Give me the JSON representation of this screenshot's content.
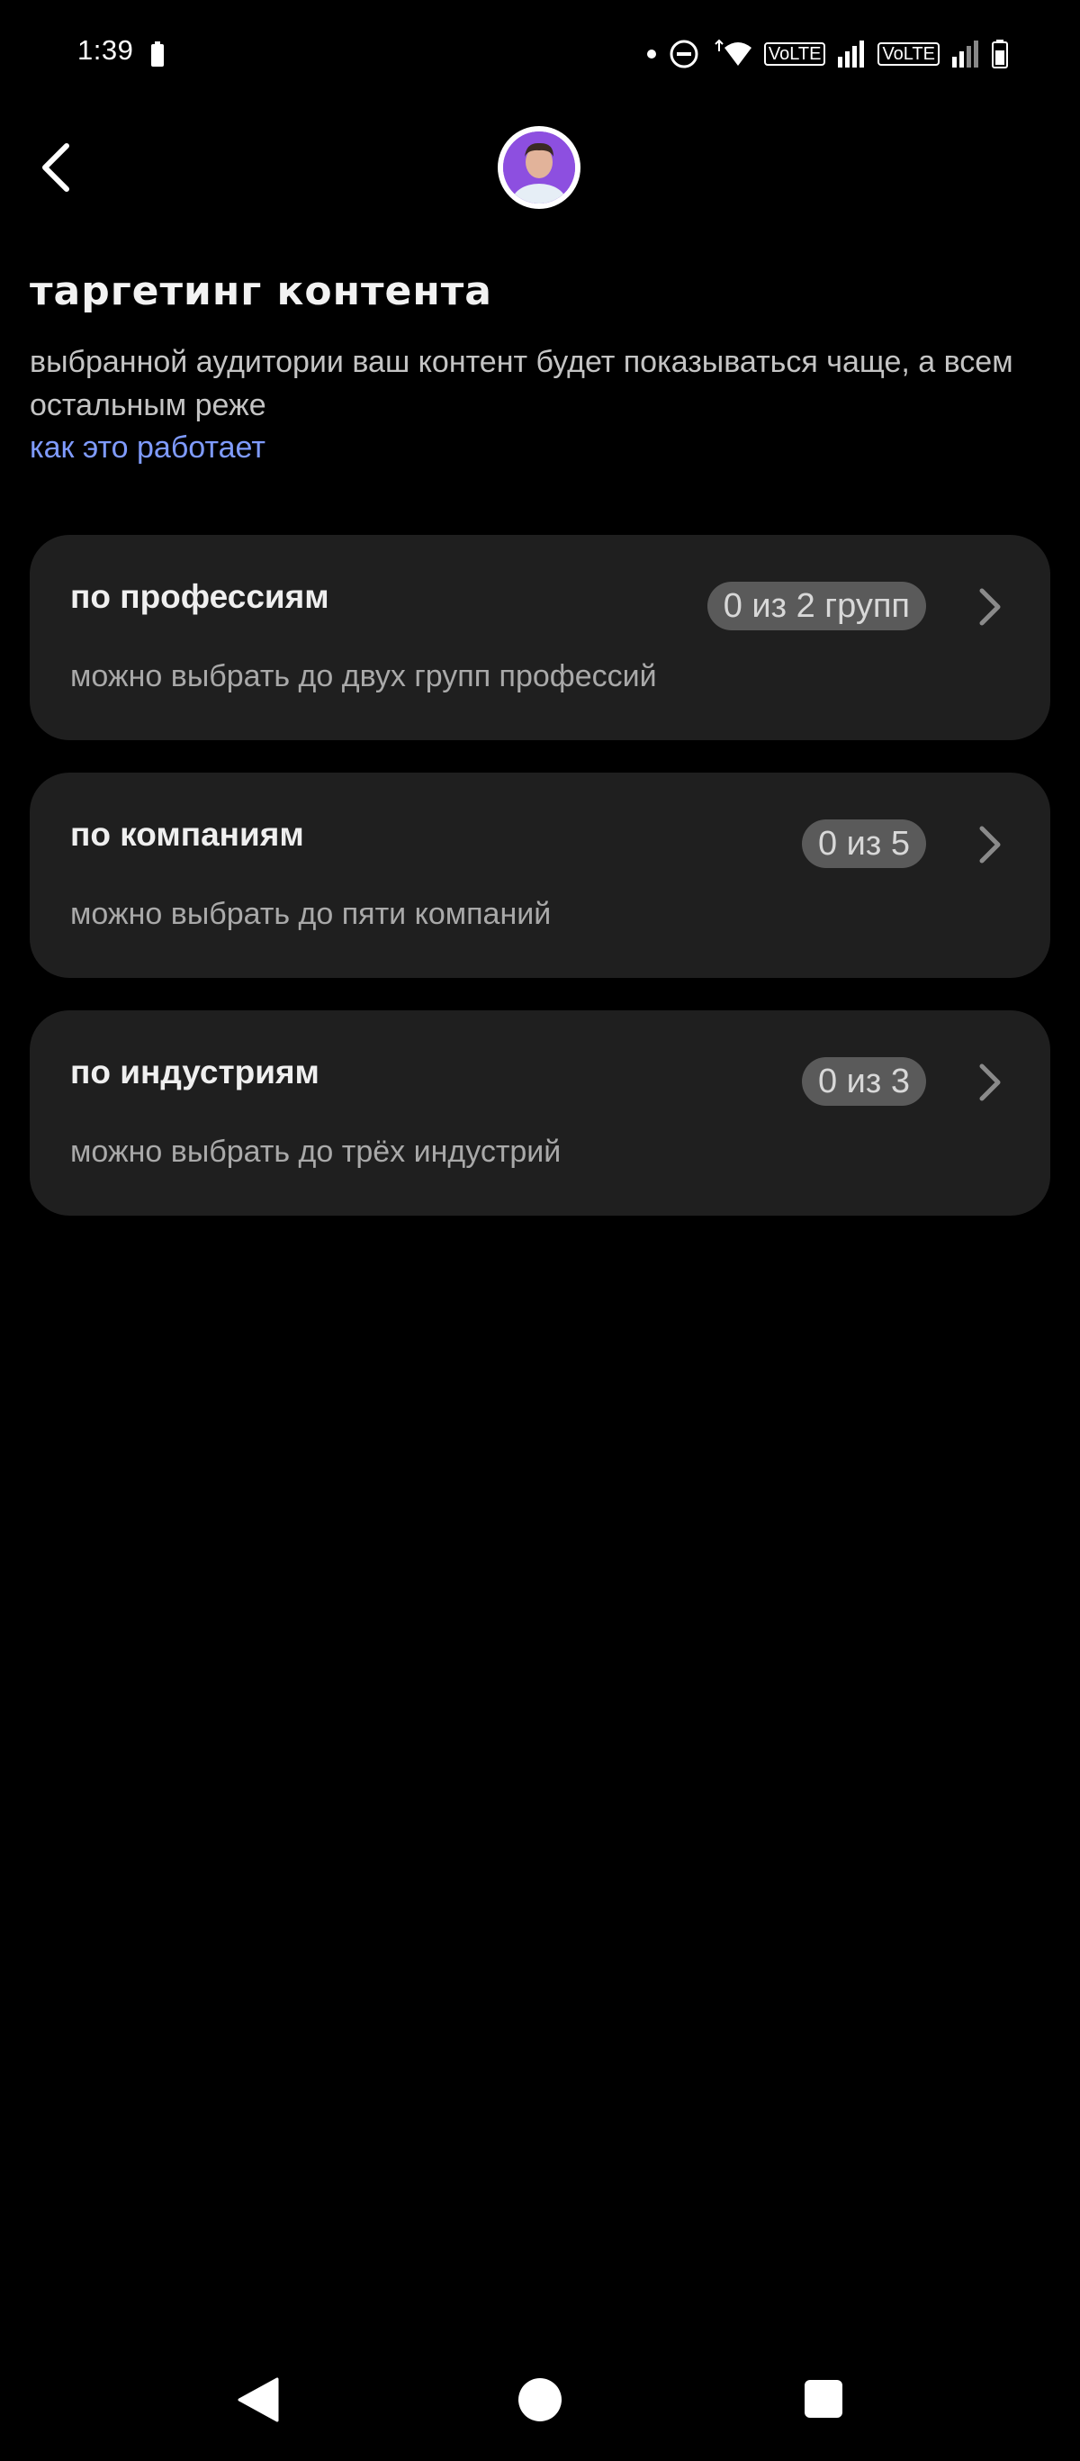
{
  "status_bar": {
    "time": "1:39",
    "volte1": "VoLTE",
    "volte2": "VoLTE"
  },
  "header": {
    "back_icon": "chevron-left-icon",
    "avatar_icon": "user-avatar"
  },
  "page": {
    "title": "таргетинг контента",
    "subtitle": "выбранной аудитории ваш контент будет показываться чаще, а всем остальным реже",
    "help_link": "как это работает"
  },
  "cards": [
    {
      "title": "по профессиям",
      "badge": "0 из 2 групп",
      "description": "можно выбрать до двух групп профессий"
    },
    {
      "title": "по компаниям",
      "badge": "0 из 5",
      "description": "можно выбрать до пяти компаний"
    },
    {
      "title": "по индустриям",
      "badge": "0 из 3",
      "description": "можно выбрать до трёх индустрий"
    }
  ],
  "colors": {
    "background": "#000000",
    "card": "#1f1f1f",
    "link": "#7f9bff",
    "badge": "#5a5a5a"
  }
}
